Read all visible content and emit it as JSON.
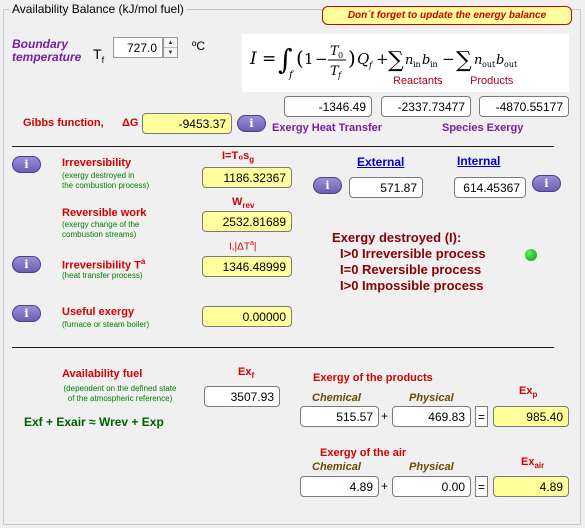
{
  "frame": {
    "title": "Availability Balance (kJ/mol fuel)"
  },
  "reminder": "Don´t forget to update the energy balance",
  "boundary": {
    "label_line1": "Boundary",
    "label_line2": "temperature",
    "symbol": "T",
    "symbol_sub": "f",
    "value": "727.0",
    "unit": "ºC"
  },
  "formula": {
    "reactants": "Reactants",
    "products": "Products",
    "heat_transfer_value": "-1346.49",
    "reactants_exergy_value": "-2337.73477",
    "products_exergy_value": "-4870.55177",
    "heat_transfer_label": "Exergy Heat Transfer",
    "species_label": "Species Exergy"
  },
  "gibbs": {
    "label": "Gibbs function,",
    "symbol": "ΔG",
    "value": "-9453.37"
  },
  "info_label": "i",
  "irreversibility": {
    "label": "Irreversibility",
    "desc_line1": "(exergy destroyed in",
    "desc_line2": "the combustion process)",
    "formula": "I=T₀s",
    "formula_sub": "g",
    "value": "1186.32367"
  },
  "external": {
    "label": "External",
    "value": "571.87"
  },
  "internal": {
    "label": "Internal",
    "value": "614.45367"
  },
  "reversible_work": {
    "label": "Reversible work",
    "desc_line1": "(exergy change of the",
    "desc_line2": "combustion streams)",
    "symbol": "W",
    "symbol_sub": "rev",
    "value": "2532.81689"
  },
  "exergy_destroyed": {
    "title": "Exergy destroyed (I):",
    "line1": "I>0 Irreversible process",
    "line2": "I=0 Reversible process",
    "line3": "I>0 Impossible process"
  },
  "irreversibility_t": {
    "label": "Irreversibility T",
    "label_sup": "a",
    "desc": "(heat transfer process)",
    "formula": "I,|ΔT",
    "formula_sup": "a",
    "formula_end": "|",
    "value": "1346.48999"
  },
  "useful_exergy": {
    "label": "Useful exergy",
    "desc": "(furnace or steam boiler)",
    "value": "0.00000"
  },
  "availability_fuel": {
    "label": "Availability fuel",
    "desc_line1": "(dependent on the defined state",
    "desc_line2": "of the atmospheric reference)",
    "symbol": "Ex",
    "symbol_sub": "f",
    "value": "3507.93",
    "balance_eq": "Exf + Exair ≈ Wrev + Exp"
  },
  "products": {
    "title": "Exergy of the products",
    "chemical_label": "Chemical",
    "physical_label": "Physical",
    "chemical_value": "515.57",
    "physical_value": "469.83",
    "symbol": "Ex",
    "symbol_sub": "p",
    "total_value": "985.40"
  },
  "air": {
    "title": "Exergy of the air",
    "chemical_label": "Chemical",
    "physical_label": "Physical",
    "chemical_value": "4.89",
    "physical_value": "0.00",
    "symbol": "Ex",
    "symbol_sub": "air",
    "total_value": "4.89"
  },
  "ops": {
    "plus": "+",
    "equals": "="
  },
  "colors": {
    "highlight": "#ffff9b",
    "label_red": "#d40000",
    "info_purple": "#6c5fb4",
    "status_led": "#1fb81f"
  }
}
